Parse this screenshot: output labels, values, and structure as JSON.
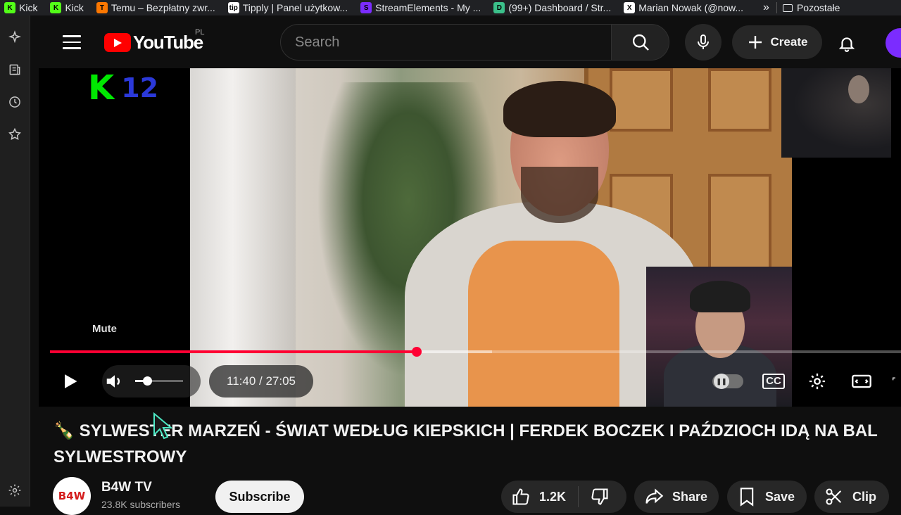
{
  "bookmarks": [
    {
      "label": "Kick",
      "icon": "kick-icon",
      "color": "#53fc18",
      "glyph": "K"
    },
    {
      "label": "Kick",
      "icon": "kick-icon",
      "color": "#53fc18",
      "glyph": "K"
    },
    {
      "label": "Temu – Bezpłatny zwr...",
      "icon": "temu-icon",
      "color": "#fb7701",
      "glyph": "T"
    },
    {
      "label": "Tipply | Panel użytkow...",
      "icon": "tipply-icon",
      "color": "#ffffff",
      "glyph": "tip"
    },
    {
      "label": "StreamElements - My ...",
      "icon": "streamelements-icon",
      "color": "#7b2cff",
      "glyph": "S"
    },
    {
      "label": "(99+) Dashboard / Str...",
      "icon": "dashboard-icon",
      "color": "#3bc08a",
      "glyph": "D"
    },
    {
      "label": "Marian Nowak (@now...",
      "icon": "x-icon",
      "color": "#ffffff",
      "glyph": "X"
    }
  ],
  "bookmarks_more": "»",
  "bookmarks_other": "Pozostałe",
  "header": {
    "logo_text": "YouTube",
    "region": "PL",
    "search_placeholder": "Search",
    "create_label": "Create"
  },
  "player": {
    "overlay_logo_k": "K",
    "overlay_logo_num": "12",
    "mute_tooltip": "Mute",
    "time_current": "11:40",
    "time_total": "27:05",
    "time_display": "11:40 / 27:05",
    "progress_fraction": 0.4313,
    "buffer_fraction": 0.5198,
    "volume_fraction": 0.25,
    "autoplay_on": false,
    "cc_label": "CC",
    "accent_color": "#ff0033"
  },
  "video": {
    "title_emoji": "🍾",
    "title": "SYLWESTER MARZEŃ - ŚWIAT WEDŁUG KIEPSKICH | FERDEK BOCZEK I PAŹDZIOCH IDĄ NA BAL SYLWESTROWY",
    "channel_name": "B4W TV",
    "channel_avatar_text": "B4W",
    "channel_subscribers": "23.8K subscribers",
    "subscribe_label": "Subscribe",
    "like_count": "1.2K",
    "share_label": "Share",
    "save_label": "Save",
    "clip_label": "Clip"
  }
}
